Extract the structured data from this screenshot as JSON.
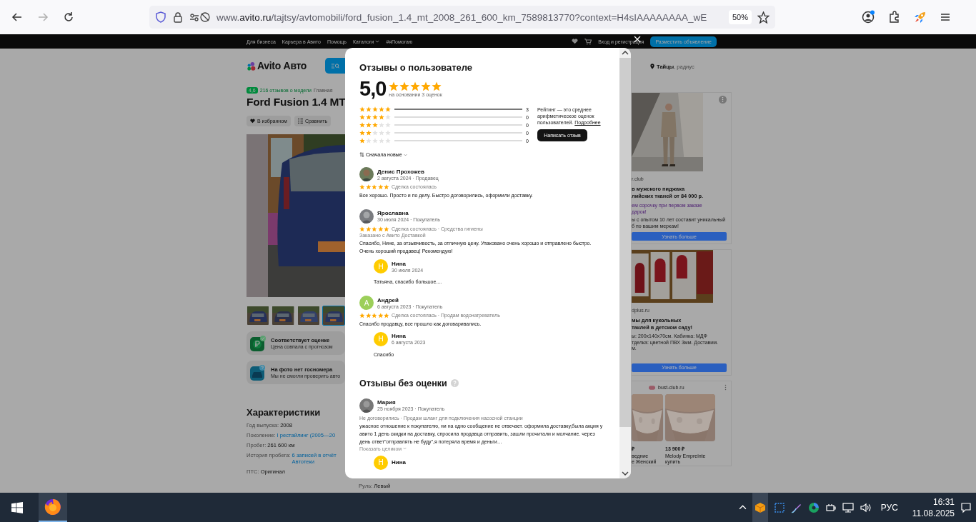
{
  "browser": {
    "url": {
      "prefix": "www.",
      "host": "avito.ru",
      "path": "/tajtsy/avtomobili/ford_fusion_1.4_mt_2008_261_600_km_7589813770?context=H4sIAAAAAAAA_wE"
    },
    "zoom": "50%",
    "forward_disabled": true
  },
  "topnav": {
    "links": [
      {
        "label": "Для бизнеса",
        "dropdown": false
      },
      {
        "label": "Карьера в Авито",
        "dropdown": false
      },
      {
        "label": "Помощь",
        "dropdown": false
      },
      {
        "label": "Каталоги",
        "dropdown": true
      },
      {
        "label": "#яПомогаю",
        "dropdown": false
      }
    ],
    "login": "Вход и регистрация",
    "post_button": "Разместить объявление"
  },
  "header": {
    "logo": "Avito Авто",
    "location": "**Тайцы**, радиус"
  },
  "listing": {
    "model_rating": "4,6",
    "model_reviews": "216 отзывов о модели",
    "breadcrumb": "Главная",
    "title": "Ford Fusion 1.4 MT",
    "actions": [
      {
        "kind": "favorite",
        "label": "В избранном"
      },
      {
        "kind": "compare",
        "label": "Сравнить"
      }
    ],
    "thumbnails": [
      {
        "selected": false
      },
      {
        "selected": false
      },
      {
        "selected": false
      },
      {
        "selected": true
      }
    ],
    "badges": [
      {
        "kind": "price",
        "title": "Соответствует оценке",
        "subtitle": "Цена совпала с прогнозом"
      },
      {
        "kind": "plate",
        "title": "На фото нет госномера",
        "subtitle": "Мы не смогли проверить авто"
      }
    ],
    "specs_title": "Характеристики",
    "specs": [
      {
        "label": "Год выпуска:",
        "value": "2008",
        "kind": "text"
      },
      {
        "label": "Поколение:",
        "value": "I рестайлинг (2005—20",
        "kind": "link"
      },
      {
        "label": "Пробег:",
        "value": "261 600 км",
        "kind": "text"
      },
      {
        "label": "История пробега:",
        "value": "6 записей в отчёт Автотеки",
        "kind": "link"
      },
      {
        "label": "ПТС:",
        "value": "Оригинал",
        "kind": "text"
      }
    ],
    "specs_right": [
      {
        "label": "Руль:",
        "value": "Левый",
        "kind": "text"
      }
    ]
  },
  "ads": [
    {
      "kind": "single",
      "domain": "r.club",
      "title": "в мужского пиджака\nлийских тканей от 84 000 р.",
      "promo": "ем сорочку при первом заказе\nдарок!",
      "text": "ы с опытом 10 лет составит уникальный\nб по вашим меркам!",
      "button": "Узнать больше"
    },
    {
      "kind": "triple",
      "domain": "dplus.ru",
      "title": "мы для кукольных\nтаклей в детском саду!",
      "text": "ы: 200х140х70см. Кабинка: МДФ\nтделка: цветной ПВХ 3мм. Доставим.\nм.",
      "button": "Узнать больше"
    },
    {
      "kind": "products",
      "domain": "bust-club.ru",
      "products": [
        {
          "price": "₽",
          "name": "ведние\nе Женский"
        },
        {
          "price": "13 900 ₽",
          "name": "Melody Empreinte\nкупить"
        }
      ]
    }
  ],
  "modal": {
    "title": "Отзывы о пользователе",
    "score": "5,0",
    "stars": 5,
    "basis": "на основании 3 оценок",
    "distribution": [
      {
        "stars": 5,
        "level": 1,
        "count": "3"
      },
      {
        "stars": 4,
        "level": 0,
        "count": "0"
      },
      {
        "stars": 3,
        "level": 0,
        "count": "0"
      },
      {
        "stars": 2,
        "level": 0,
        "count": "0"
      },
      {
        "stars": 1,
        "level": 0,
        "count": "0"
      }
    ],
    "info": "Рейтинг — это среднее арифметическое оценок пользователей.",
    "info_link": "Подробнее",
    "write_button": "Написать отзыв",
    "sort": "Сначала новые",
    "reviews": [
      {
        "name": "Денис Прохожев",
        "meta": "2 августа 2024 · Продавец",
        "stars": 5,
        "deal": "Сделка состоялась",
        "text": "Все хорошо. Просто и по делу. Быстро договорились, оформили доставку."
      },
      {
        "name": "Ярославна",
        "meta": "30 июля 2024 · Покупатель",
        "stars": 5,
        "deal": "Сделка состоялась · Средства гигиены",
        "note": "Заказано с Авито Доставкой",
        "text": "Спасибо, Нине, за отзывчивость, за отличную цену. Упаковано очень хорошо и отправлено быстро. Очень хороший продавец! Рекомендую!",
        "reply": {
          "avatar": {
            "kind": "letter",
            "letter": "Н",
            "color": "#ffcc00"
          },
          "name": "Нина",
          "meta": "30 июля 2024",
          "text": "Татьяна, спасибо большое...."
        }
      },
      {
        "avatar": {
          "kind": "letter",
          "letter": "А",
          "color": "#9ccf5a"
        },
        "name": "Андрей",
        "meta": "6 августа 2023 · Покупатель",
        "stars": 5,
        "deal": "Сделка состоялась · Продам водонагреватель",
        "text": "Спасибо продавцу, все прошло как договаривались.",
        "reply": {
          "avatar": {
            "kind": "letter",
            "letter": "Н",
            "color": "#ffcc00"
          },
          "name": "Нина",
          "meta": "6 августа 2023",
          "text": "Спасибо"
        }
      }
    ],
    "unrated_title": "Отзывы без оценки",
    "unrated": [
      {
        "name": "Мария",
        "meta": "25 ноября 2023 · Покупатель",
        "deal": "Не договорились · Продам шланг для подключения насосной станции",
        "text": "ужасное отношение к покупателю, ни на одно сообщение не отвечает. оформила доставку,была акция у авито 1 день скидки на доставку, спросила продавца отправить, зашли прочитали и молчание. через день ответ\"отправлять не буду\",я потеряла время и деньги…",
        "expand": "Показать целиком",
        "reply": {
          "avatar": {
            "kind": "letter",
            "letter": "Н",
            "color": "#ffcc00"
          },
          "name": "Нина"
        }
      }
    ]
  },
  "taskbar": {
    "language": "РУС",
    "time": "16:31",
    "date": "11.08.2025"
  }
}
